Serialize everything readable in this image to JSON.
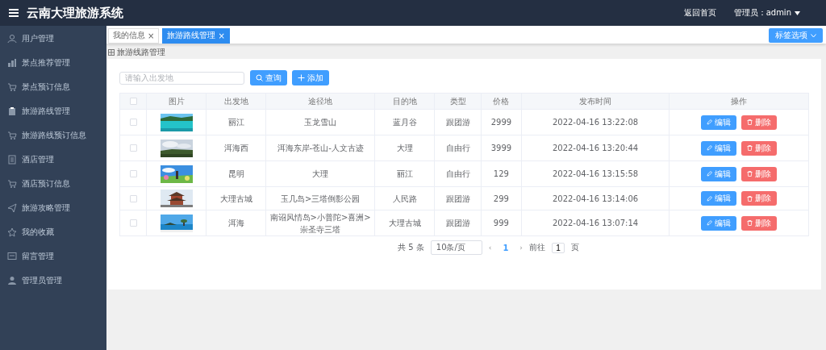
{
  "header": {
    "title": "云南大理旅游系统",
    "home_link": "返回首页",
    "user_menu": "管理员：admin"
  },
  "sidebar": {
    "items": [
      {
        "label": "用户管理",
        "selected": false
      },
      {
        "label": "景点推荐管理",
        "selected": false
      },
      {
        "label": "景点预订信息",
        "selected": false
      },
      {
        "label": "旅游路线管理",
        "selected": false
      },
      {
        "label": "旅游路线预订信息",
        "selected": false
      },
      {
        "label": "酒店管理",
        "selected": false
      },
      {
        "label": "酒店预订信息",
        "selected": false
      },
      {
        "label": "旅游攻略管理",
        "selected": false
      },
      {
        "label": "我的收藏",
        "selected": false
      },
      {
        "label": "留言管理",
        "selected": false
      },
      {
        "label": "管理员管理",
        "selected": false
      }
    ]
  },
  "tabs": [
    {
      "label": "我的信息",
      "selected": false,
      "close": "×"
    },
    {
      "label": "旅游路线管理",
      "selected": true,
      "close": "×"
    }
  ],
  "tab_options": "标签选项",
  "breadcrumb": "旅游线路管理",
  "search": {
    "placeholder": "请输入出发地",
    "query_button": "查询",
    "add_button": "添加"
  },
  "table": {
    "select_all": {
      "checked": false
    },
    "columns": [
      "图片",
      "出发地",
      "途径地",
      "目的地",
      "类型",
      "价格",
      "发布时间",
      "操作"
    ],
    "rows": [
      {
        "checked": false,
        "from": "丽江",
        "via": "玉龙雪山",
        "to": "蓝月谷",
        "type": "跟团游",
        "price": "2999",
        "time": "2022-04-16 13:22:08",
        "edit": "编辑",
        "delete": "删除"
      },
      {
        "checked": false,
        "from": "洱海西",
        "via": "洱海东岸-苍山-人文古迹",
        "to": "大理",
        "type": "自由行",
        "price": "3999",
        "time": "2022-04-16 13:20:44",
        "edit": "编辑",
        "delete": "删除"
      },
      {
        "checked": false,
        "from": "昆明",
        "via": "大理",
        "to": "丽江",
        "type": "自由行",
        "price": "129",
        "time": "2022-04-16 13:15:58",
        "edit": "编辑",
        "delete": "删除"
      },
      {
        "checked": false,
        "from": "大理古城",
        "via": "玉几岛>三塔倒影公园",
        "to": "人民路",
        "type": "跟团游",
        "price": "299",
        "time": "2022-04-16 13:14:06",
        "edit": "编辑",
        "delete": "删除"
      },
      {
        "checked": false,
        "from": "洱海",
        "via": "南诏风情岛>小普陀>喜洲>崇圣寺三塔",
        "to": "大理古城",
        "type": "跟团游",
        "price": "999",
        "time": "2022-04-16 13:07:14",
        "edit": "编辑",
        "delete": "删除"
      }
    ]
  },
  "pagination": {
    "total": "共 5 条",
    "page_size": "10条/页",
    "prev": "‹",
    "pages": [
      {
        "label": "1",
        "selected": true
      }
    ],
    "next": "›",
    "goto_label": "前往",
    "goto_value": "1",
    "goto_unit": "页"
  }
}
